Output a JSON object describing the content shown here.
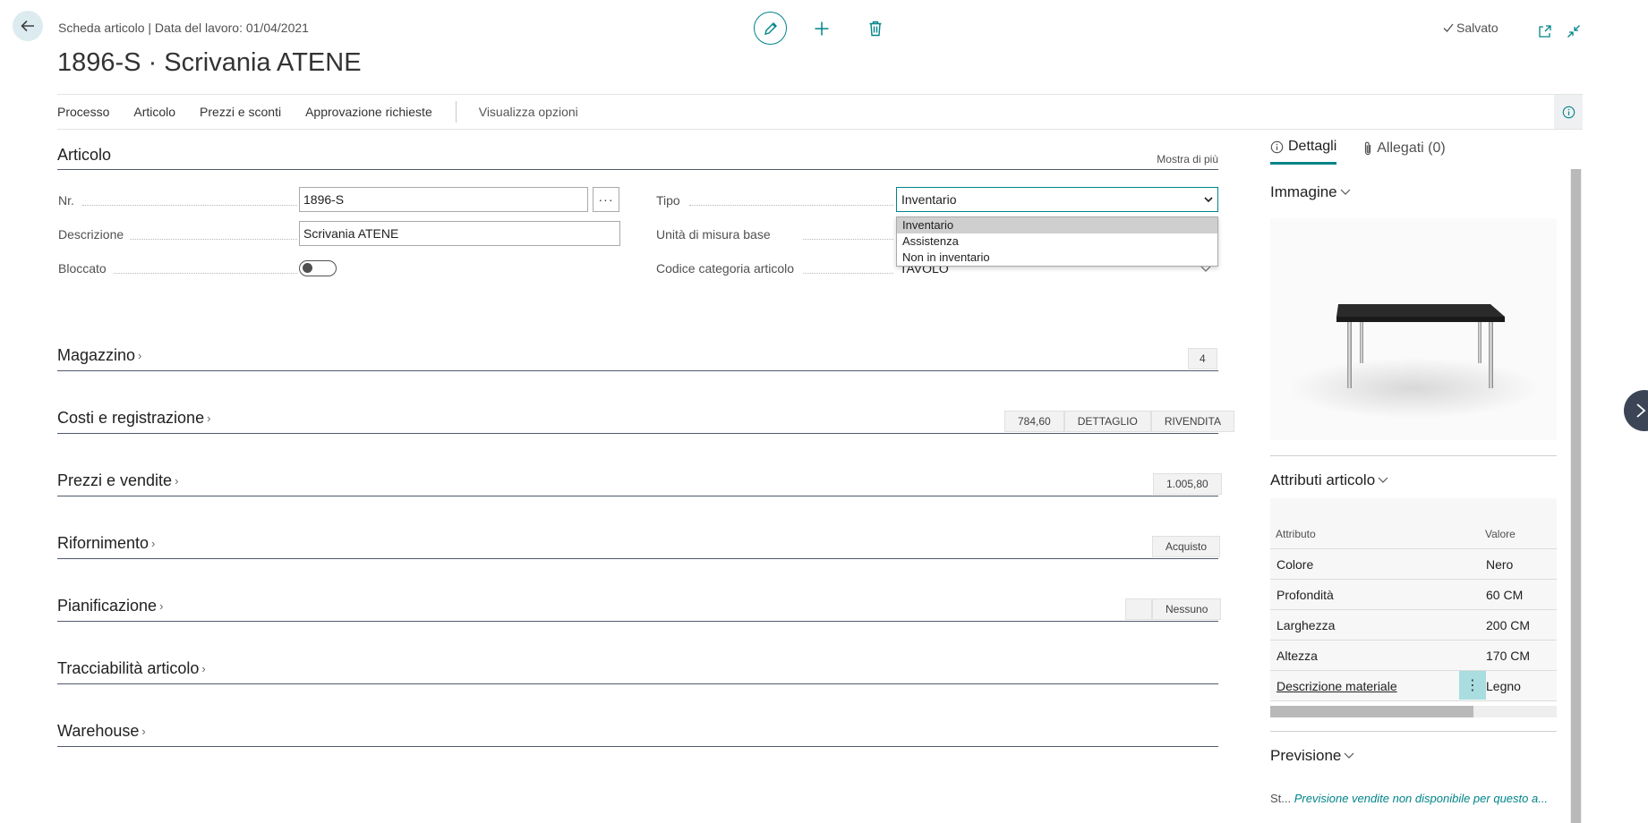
{
  "header": {
    "breadcrumb": "Scheda articolo | Data del lavoro: 01/04/2021",
    "title": "1896-S · Scrivania ATENE",
    "saved_label": "Salvato"
  },
  "action_bar": {
    "items": [
      "Processo",
      "Articolo",
      "Prezzi e sconti",
      "Approvazione richieste"
    ],
    "view_options": "Visualizza opzioni"
  },
  "item_section": {
    "title": "Articolo",
    "show_more": "Mostra di più",
    "fields": {
      "nr_label": "Nr.",
      "nr_value": "1896-S",
      "descrizione_label": "Descrizione",
      "descrizione_value": "Scrivania ATENE",
      "bloccato_label": "Bloccato",
      "bloccato_value": false,
      "tipo_label": "Tipo",
      "tipo_value": "Inventario",
      "unita_label": "Unità di misura base",
      "categoria_label": "Codice categoria articolo",
      "categoria_value": "TAVOLO"
    },
    "tipo_options": [
      "Inventario",
      "Assistenza",
      "Non in inventario"
    ]
  },
  "sections": [
    {
      "title": "Magazzino",
      "badges": [
        "4"
      ]
    },
    {
      "title": "Costi e registrazione",
      "badges": [
        "784,60",
        "DETTAGLIO",
        "RIVENDITA"
      ]
    },
    {
      "title": "Prezzi e vendite",
      "badges": [
        "1.005,80"
      ]
    },
    {
      "title": "Rifornimento",
      "badges": [
        "Acquisto"
      ]
    },
    {
      "title": "Pianificazione",
      "badges": [
        "",
        "Nessuno"
      ]
    },
    {
      "title": "Tracciabilità articolo",
      "badges": []
    },
    {
      "title": "Warehouse",
      "badges": []
    }
  ],
  "factbox": {
    "tab_details": "Dettagli",
    "tab_attachments": "Allegati (0)",
    "image_title": "Immagine",
    "attributes_title": "Attributi articolo",
    "attr_header": {
      "name": "Attributo",
      "value": "Valore"
    },
    "attributes": [
      {
        "name": "Colore",
        "value": "Nero"
      },
      {
        "name": "Profondità",
        "value": "60 CM"
      },
      {
        "name": "Larghezza",
        "value": "200 CM"
      },
      {
        "name": "Altezza",
        "value": "170 CM"
      },
      {
        "name": "Descrizione materiale",
        "value": "Legno"
      }
    ],
    "forecast_title": "Previsione",
    "forecast_prefix": "St...",
    "forecast_text": "Previsione vendite non disponibile per questo a..."
  },
  "colors": {
    "accent": "#008489",
    "nav_button": "#3b4556",
    "table_top": "#2b2b2b"
  }
}
